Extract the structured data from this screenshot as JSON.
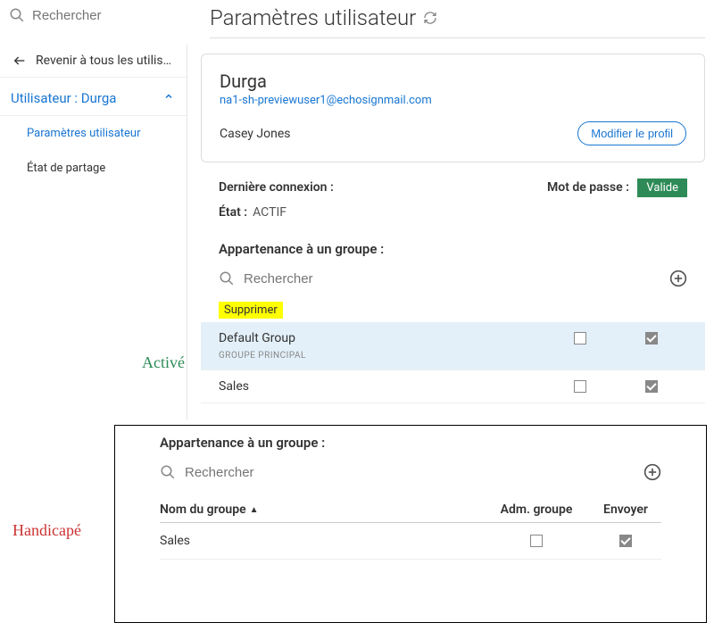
{
  "global_search": {
    "placeholder": "Rechercher"
  },
  "header": {
    "title": "Paramètres utilisateur"
  },
  "sidebar": {
    "back_label": "Revenir à tous les utilis…",
    "user_header": "Utilisateur : Durga",
    "items": [
      {
        "label": "Paramètres utilisateur",
        "active": true
      },
      {
        "label": "État de partage",
        "active": false
      }
    ]
  },
  "profile": {
    "name": "Durga",
    "email": "na1-sh-previewuser1@echosignmail.com",
    "company": "Casey Jones",
    "edit_button": "Modifier le profil"
  },
  "meta": {
    "last_login_label": "Dernière connexion :",
    "last_login_value": "",
    "password_label": "Mot de passe :",
    "password_badge": "Valide",
    "status_label": "État :",
    "status_value": "ACTIF"
  },
  "group_section": {
    "title": "Appartenance à un groupe :",
    "search_placeholder": "Rechercher",
    "delete_label": "Supprimer",
    "enabled_annotation": "Activé",
    "rows": [
      {
        "name": "Default Group",
        "subtitle": "GROUPE PRINCIPAL",
        "admin": false,
        "send": true
      },
      {
        "name": "Sales",
        "subtitle": "",
        "admin": false,
        "send": true
      }
    ]
  },
  "disabled_annotation": "Handicapé",
  "overlay": {
    "title": "Appartenance à un groupe :",
    "search_placeholder": "Rechercher",
    "columns": {
      "name": "Nom du groupe",
      "admin": "Adm. groupe",
      "send": "Envoyer"
    },
    "rows": [
      {
        "name": "Sales",
        "admin": false,
        "send": true
      }
    ]
  }
}
